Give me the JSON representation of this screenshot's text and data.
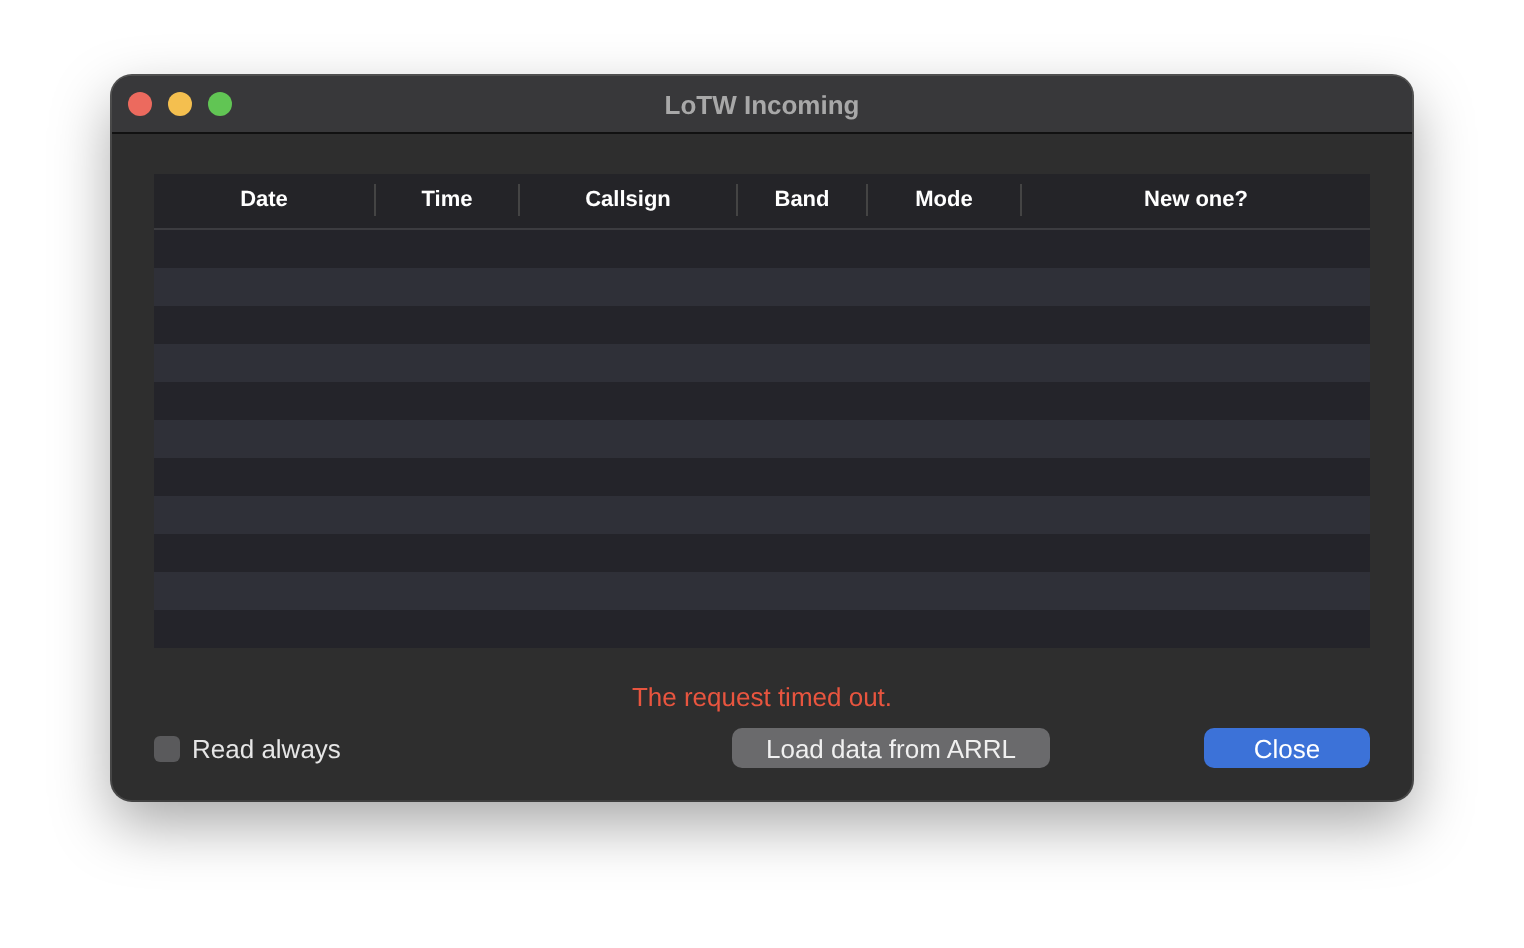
{
  "window": {
    "title": "LoTW Incoming"
  },
  "table": {
    "columns": [
      "Date",
      "Time",
      "Callsign",
      "Band",
      "Mode",
      "New one?"
    ]
  },
  "status_message": "The request timed out.",
  "checkbox": {
    "label": "Read always",
    "checked": false
  },
  "buttons": [
    {
      "label": "Load data from ARRL",
      "kind": "plain"
    },
    {
      "label": "Close",
      "kind": "default"
    }
  ]
}
